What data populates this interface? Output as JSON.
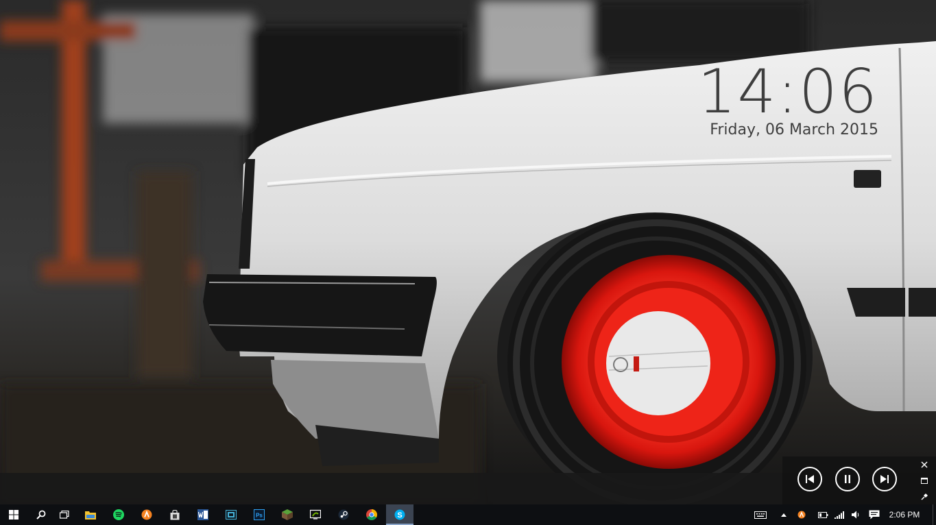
{
  "clock": {
    "time": "14:06",
    "date": "Friday, 06 March 2015"
  },
  "media_controls": {
    "buttons": [
      "previous-track-icon",
      "pause-icon",
      "next-track-icon"
    ],
    "side": [
      "close-icon",
      "restore-icon",
      "pin-icon"
    ]
  },
  "taskbar": {
    "left": [
      "windows-start-icon",
      "search-icon",
      "task-view-icon"
    ],
    "apps": [
      "file-explorer-icon",
      "spotify-icon",
      "avast-icon",
      "windows-store-icon",
      "word-icon",
      "media-player-icon",
      "photoshop-icon",
      "minecraft-icon",
      "nvidia-shadowplay-icon",
      "steam-icon",
      "chrome-icon",
      "skype-icon"
    ],
    "active_app": "skype-icon",
    "tray": [
      "touch-keyboard-icon",
      "show-hidden-icons-icon",
      "avast-tray-icon",
      "battery-icon",
      "network-signal-icon",
      "volume-icon",
      "action-center-icon"
    ],
    "time": "2:06 PM"
  },
  "colors": {
    "accent_red": "#e0201a",
    "taskbar_bg": "#0d0f12",
    "clock_text": "#3e3e3e"
  }
}
